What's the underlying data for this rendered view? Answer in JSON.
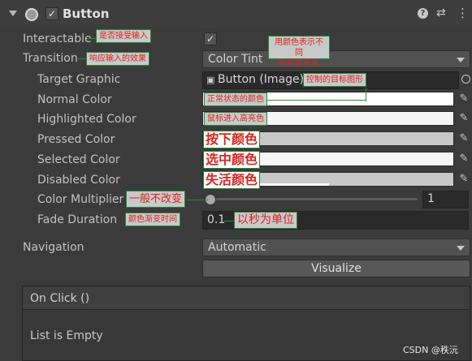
{
  "header": {
    "title": "Button",
    "enabled": true,
    "help_icon": "help-icon",
    "presets_icon": "presets-icon",
    "more_icon": "more-icon"
  },
  "fields": {
    "interactable": {
      "label": "Interactable",
      "checked": true
    },
    "transition": {
      "label": "Transition",
      "value": "Color Tint"
    },
    "target_graphic": {
      "label": "Target Graphic",
      "value": "Button (Image)"
    },
    "normal_color": {
      "label": "Normal Color",
      "color": "#ffffff"
    },
    "highlighted_color": {
      "label": "Highlighted Color",
      "color": "#f5f5f5"
    },
    "pressed_color": {
      "label": "Pressed Color",
      "color": "#c8c8c8"
    },
    "selected_color": {
      "label": "Selected Color",
      "color": "#f5f5f5"
    },
    "disabled_color": {
      "label": "Disabled Color",
      "color": "#c8c8c8"
    },
    "color_multiplier": {
      "label": "Color Multiplier",
      "value": "1",
      "slider_fraction": 0.0
    },
    "fade_duration": {
      "label": "Fade Duration",
      "value": "0.1"
    },
    "navigation": {
      "label": "Navigation",
      "value": "Automatic"
    },
    "visualize": {
      "label": "Visualize"
    }
  },
  "on_click": {
    "title": "On Click ()",
    "empty_text": "List is Empty"
  },
  "annotations": {
    "interactable": "是否接受输入",
    "transition": "响应输入的效果",
    "color_tint_line1": "用颜色表示不同",
    "color_tint_line2": "的状态变化",
    "target": "控制的目标图形",
    "normal": "正常状态的颜色",
    "highlighted": "鼠标进入高亮色",
    "pressed": "按下颜色",
    "selected": "选中颜色",
    "disabled": "失活颜色",
    "multiplier": "一般不改变",
    "fade": "颜色渐变时间",
    "seconds": "以秒为单位"
  },
  "watermark": "CSDN @秩沅"
}
